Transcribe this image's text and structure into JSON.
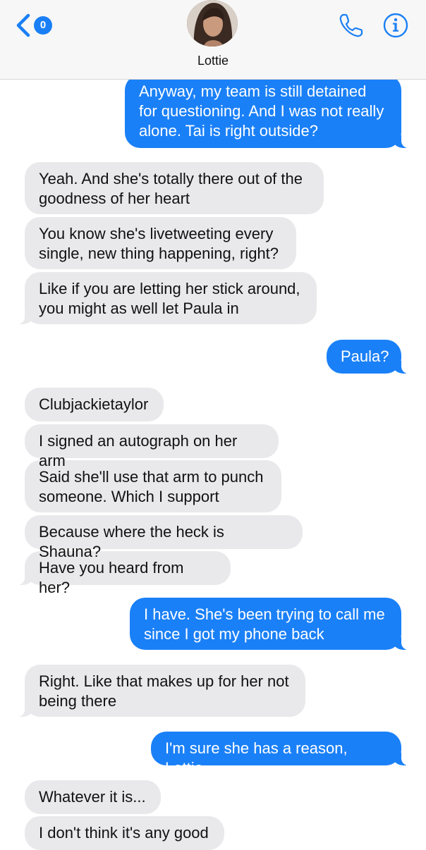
{
  "header": {
    "back_count": "0",
    "contact_name": "Lottie",
    "icons": {
      "back": "chevron-left-icon",
      "phone": "phone-icon",
      "info": "info-icon"
    },
    "accent_color": "#1a80f7"
  },
  "messages": [
    {
      "from": "me",
      "text": "Anyway, my team is still detained for questioning. And I was not really alone. Tai is right outside?"
    },
    {
      "from": "them",
      "text": "Yeah. And she's totally there out of the goodness of her heart"
    },
    {
      "from": "them",
      "text": "You know she's livetweeting every single, new thing happening, right?"
    },
    {
      "from": "them",
      "text": "Like if you are letting her stick around, you might as well let Paula in"
    },
    {
      "from": "me",
      "text": "Paula?"
    },
    {
      "from": "them",
      "text": "Clubjackietaylor"
    },
    {
      "from": "them",
      "text": "I signed an autograph on her arm"
    },
    {
      "from": "them",
      "text": "Said she'll use that arm to punch someone. Which I support"
    },
    {
      "from": "them",
      "text": "Because where the heck is Shauna?"
    },
    {
      "from": "them",
      "text": "Have you heard from her?"
    },
    {
      "from": "me",
      "text": "I have. She's been trying to call me since I got my phone back"
    },
    {
      "from": "them",
      "text": "Right. Like that makes up for her not being there"
    },
    {
      "from": "me",
      "text": "I'm sure she has a reason, Lottie"
    },
    {
      "from": "them",
      "text": "Whatever it is..."
    },
    {
      "from": "them",
      "text": "I don't think it's any good"
    }
  ]
}
